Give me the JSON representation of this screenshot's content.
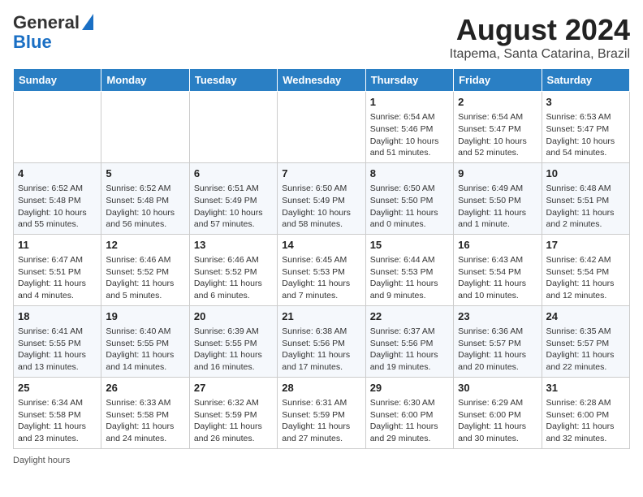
{
  "header": {
    "logo_line1": "General",
    "logo_line2": "Blue",
    "title": "August 2024",
    "subtitle": "Itapema, Santa Catarina, Brazil"
  },
  "calendar": {
    "days_of_week": [
      "Sunday",
      "Monday",
      "Tuesday",
      "Wednesday",
      "Thursday",
      "Friday",
      "Saturday"
    ],
    "weeks": [
      [
        {
          "day": "",
          "detail": ""
        },
        {
          "day": "",
          "detail": ""
        },
        {
          "day": "",
          "detail": ""
        },
        {
          "day": "",
          "detail": ""
        },
        {
          "day": "1",
          "detail": "Sunrise: 6:54 AM\nSunset: 5:46 PM\nDaylight: 10 hours and 51 minutes."
        },
        {
          "day": "2",
          "detail": "Sunrise: 6:54 AM\nSunset: 5:47 PM\nDaylight: 10 hours and 52 minutes."
        },
        {
          "day": "3",
          "detail": "Sunrise: 6:53 AM\nSunset: 5:47 PM\nDaylight: 10 hours and 54 minutes."
        }
      ],
      [
        {
          "day": "4",
          "detail": "Sunrise: 6:52 AM\nSunset: 5:48 PM\nDaylight: 10 hours and 55 minutes."
        },
        {
          "day": "5",
          "detail": "Sunrise: 6:52 AM\nSunset: 5:48 PM\nDaylight: 10 hours and 56 minutes."
        },
        {
          "day": "6",
          "detail": "Sunrise: 6:51 AM\nSunset: 5:49 PM\nDaylight: 10 hours and 57 minutes."
        },
        {
          "day": "7",
          "detail": "Sunrise: 6:50 AM\nSunset: 5:49 PM\nDaylight: 10 hours and 58 minutes."
        },
        {
          "day": "8",
          "detail": "Sunrise: 6:50 AM\nSunset: 5:50 PM\nDaylight: 11 hours and 0 minutes."
        },
        {
          "day": "9",
          "detail": "Sunrise: 6:49 AM\nSunset: 5:50 PM\nDaylight: 11 hours and 1 minute."
        },
        {
          "day": "10",
          "detail": "Sunrise: 6:48 AM\nSunset: 5:51 PM\nDaylight: 11 hours and 2 minutes."
        }
      ],
      [
        {
          "day": "11",
          "detail": "Sunrise: 6:47 AM\nSunset: 5:51 PM\nDaylight: 11 hours and 4 minutes."
        },
        {
          "day": "12",
          "detail": "Sunrise: 6:46 AM\nSunset: 5:52 PM\nDaylight: 11 hours and 5 minutes."
        },
        {
          "day": "13",
          "detail": "Sunrise: 6:46 AM\nSunset: 5:52 PM\nDaylight: 11 hours and 6 minutes."
        },
        {
          "day": "14",
          "detail": "Sunrise: 6:45 AM\nSunset: 5:53 PM\nDaylight: 11 hours and 7 minutes."
        },
        {
          "day": "15",
          "detail": "Sunrise: 6:44 AM\nSunset: 5:53 PM\nDaylight: 11 hours and 9 minutes."
        },
        {
          "day": "16",
          "detail": "Sunrise: 6:43 AM\nSunset: 5:54 PM\nDaylight: 11 hours and 10 minutes."
        },
        {
          "day": "17",
          "detail": "Sunrise: 6:42 AM\nSunset: 5:54 PM\nDaylight: 11 hours and 12 minutes."
        }
      ],
      [
        {
          "day": "18",
          "detail": "Sunrise: 6:41 AM\nSunset: 5:55 PM\nDaylight: 11 hours and 13 minutes."
        },
        {
          "day": "19",
          "detail": "Sunrise: 6:40 AM\nSunset: 5:55 PM\nDaylight: 11 hours and 14 minutes."
        },
        {
          "day": "20",
          "detail": "Sunrise: 6:39 AM\nSunset: 5:55 PM\nDaylight: 11 hours and 16 minutes."
        },
        {
          "day": "21",
          "detail": "Sunrise: 6:38 AM\nSunset: 5:56 PM\nDaylight: 11 hours and 17 minutes."
        },
        {
          "day": "22",
          "detail": "Sunrise: 6:37 AM\nSunset: 5:56 PM\nDaylight: 11 hours and 19 minutes."
        },
        {
          "day": "23",
          "detail": "Sunrise: 6:36 AM\nSunset: 5:57 PM\nDaylight: 11 hours and 20 minutes."
        },
        {
          "day": "24",
          "detail": "Sunrise: 6:35 AM\nSunset: 5:57 PM\nDaylight: 11 hours and 22 minutes."
        }
      ],
      [
        {
          "day": "25",
          "detail": "Sunrise: 6:34 AM\nSunset: 5:58 PM\nDaylight: 11 hours and 23 minutes."
        },
        {
          "day": "26",
          "detail": "Sunrise: 6:33 AM\nSunset: 5:58 PM\nDaylight: 11 hours and 24 minutes."
        },
        {
          "day": "27",
          "detail": "Sunrise: 6:32 AM\nSunset: 5:59 PM\nDaylight: 11 hours and 26 minutes."
        },
        {
          "day": "28",
          "detail": "Sunrise: 6:31 AM\nSunset: 5:59 PM\nDaylight: 11 hours and 27 minutes."
        },
        {
          "day": "29",
          "detail": "Sunrise: 6:30 AM\nSunset: 6:00 PM\nDaylight: 11 hours and 29 minutes."
        },
        {
          "day": "30",
          "detail": "Sunrise: 6:29 AM\nSunset: 6:00 PM\nDaylight: 11 hours and 30 minutes."
        },
        {
          "day": "31",
          "detail": "Sunrise: 6:28 AM\nSunset: 6:00 PM\nDaylight: 11 hours and 32 minutes."
        }
      ]
    ]
  },
  "footer": {
    "daylight_label": "Daylight hours"
  }
}
